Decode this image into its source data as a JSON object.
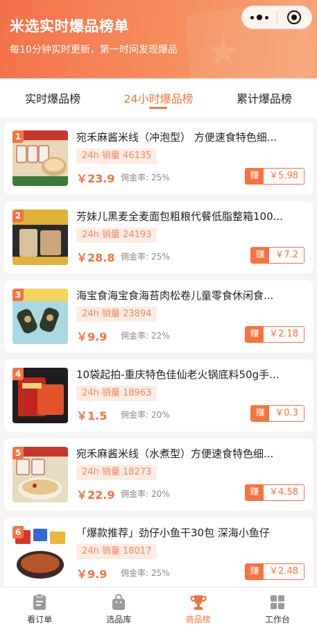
{
  "header": {
    "title": "米选实时爆品榜单",
    "subtitle": "每10分钟实时更新，第一时间发现爆品"
  },
  "tabs": [
    {
      "label": "实时爆品榜",
      "active": false
    },
    {
      "label": "24小时爆品榜",
      "active": true
    },
    {
      "label": "累计爆品榜",
      "active": false
    }
  ],
  "products": [
    {
      "rank": "1",
      "name": "宛禾麻酱米线（冲泡型） 方便速食特色细...",
      "sales": "24h 销量 46135",
      "price": "￥23.9",
      "rate_label": "佣金率:",
      "rate": "25%",
      "earn_label": "赚",
      "earn": "￥5.98"
    },
    {
      "rank": "2",
      "name": "芳妹儿黑麦全麦面包粗粮代餐低脂整箱100...",
      "sales": "24h 销量 24193",
      "price": "￥28.8",
      "rate_label": "佣金率:",
      "rate": "25%",
      "earn_label": "赚",
      "earn": "￥7.2"
    },
    {
      "rank": "3",
      "name": "海宝食海宝食海苔肉松卷儿童零食休闲食...",
      "sales": "24h 销量 23894",
      "price": "￥9.9",
      "rate_label": "佣金率:",
      "rate": "22%",
      "earn_label": "赚",
      "earn": "￥2.18"
    },
    {
      "rank": "4",
      "name": "10袋起拍-重庆特色佳仙老火锅底料50g手...",
      "sales": "24h 销量 18963",
      "price": "￥1.5",
      "rate_label": "佣金率:",
      "rate": "20%",
      "earn_label": "赚",
      "earn": "￥0.3"
    },
    {
      "rank": "5",
      "name": "宛禾麻酱米线（水煮型）方便速食特色细...",
      "sales": "24h 销量 18273",
      "price": "￥22.9",
      "rate_label": "佣金率:",
      "rate": "20%",
      "earn_label": "赚",
      "earn": "￥4.58"
    },
    {
      "rank": "6",
      "name": "「爆款推荐」劲仔小鱼干30包 深海小鱼仔",
      "sales": "24h 销量 18017",
      "price": "￥9.9",
      "rate_label": "佣金率:",
      "rate": "25%",
      "earn_label": "赚",
      "earn": "￥2.48"
    }
  ],
  "bottom_nav": [
    {
      "label": "看订单",
      "icon": "clipboard-icon",
      "active": false
    },
    {
      "label": "选品库",
      "icon": "shopping-bag-icon",
      "active": false
    },
    {
      "label": "商品榜",
      "icon": "trophy-icon",
      "active": true
    },
    {
      "label": "工作台",
      "icon": "grid-icon",
      "active": false
    }
  ],
  "colors": {
    "accent": "#f4733f",
    "header_gradient_start": "#f4714a",
    "header_gradient_end": "#f7a57a",
    "sales_bg": "#fdece4"
  }
}
